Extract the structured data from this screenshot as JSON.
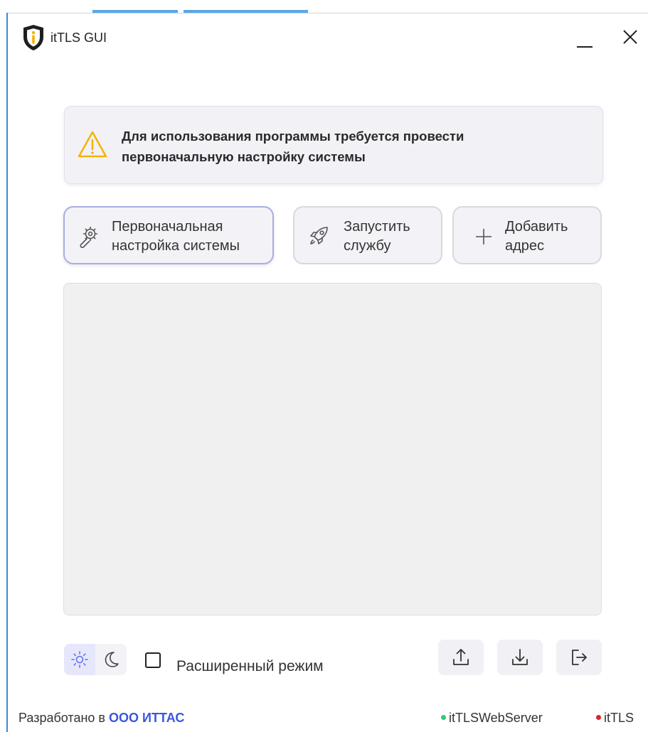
{
  "window": {
    "title": "itTLS GUI",
    "minimize_icon": "minimize-icon",
    "close_icon": "close-icon"
  },
  "alert": {
    "icon": "warning-icon",
    "line1": "Для использования программы требуется провести",
    "line2": "первоначальную настройку системы",
    "icon_color": "#f4b400"
  },
  "actions": [
    {
      "icon": "wrench-gear-icon",
      "line1": "Первоначальная",
      "line2": "настройка системы",
      "active": true
    },
    {
      "icon": "rocket-icon",
      "line1": "Запустить",
      "line2": "службу",
      "active": false
    },
    {
      "icon": "plus-icon",
      "line1": "Добавить",
      "line2": "адрес",
      "active": false
    }
  ],
  "bottom": {
    "theme_light_icon": "sun-icon",
    "theme_dark_icon": "moon-icon",
    "theme_selected": "light",
    "advanced_mode_label": "Расширенный режим",
    "advanced_mode_checked": false,
    "export_icon": "upload-icon",
    "import_icon": "download-icon",
    "logout_icon": "logout-icon"
  },
  "footer": {
    "developed_by": "Разработано в",
    "company": "ООО ИТТАС",
    "status": [
      {
        "name": "itTLSWebServer",
        "color": "#2ecc71"
      },
      {
        "name": "itTLS",
        "color": "#e0202a"
      }
    ]
  },
  "colors": {
    "accent": "#3a55e0",
    "active_border": "#a8aee0"
  }
}
